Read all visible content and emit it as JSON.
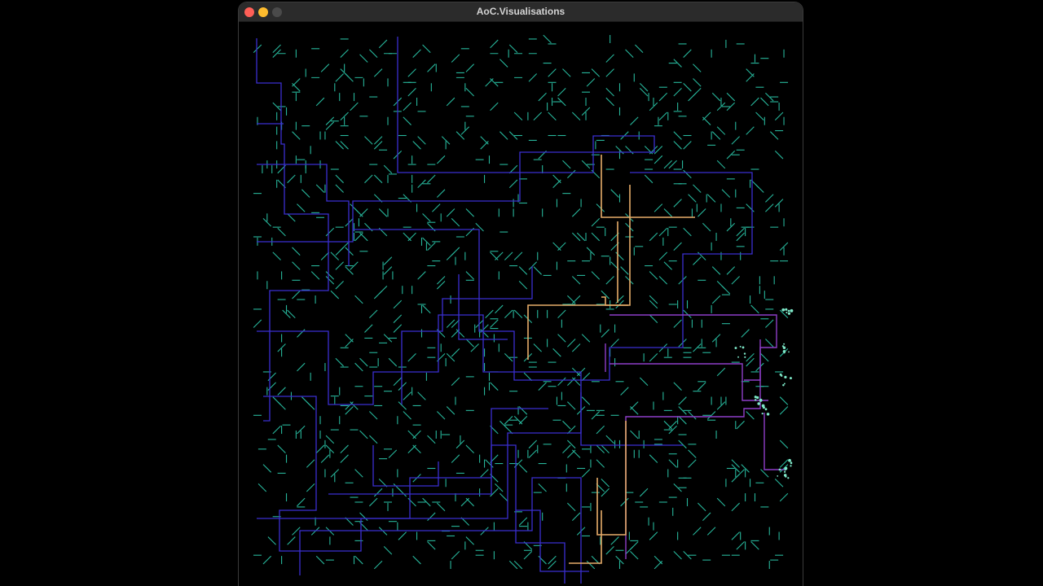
{
  "window": {
    "title": "AoC.Visualisations",
    "traffic_lights": {
      "close": "#ff5f57",
      "minimize": "#febc2e",
      "zoom": "#4a4a4a"
    }
  },
  "visualisation": {
    "background": "#000000",
    "colors": {
      "mirror": "#27b59a",
      "beam_cold": "#3b2fd0",
      "beam_mid": "#8e3ec8",
      "beam_hot": "#e7ad6a",
      "sparkle": "#7ee8c8"
    }
  }
}
